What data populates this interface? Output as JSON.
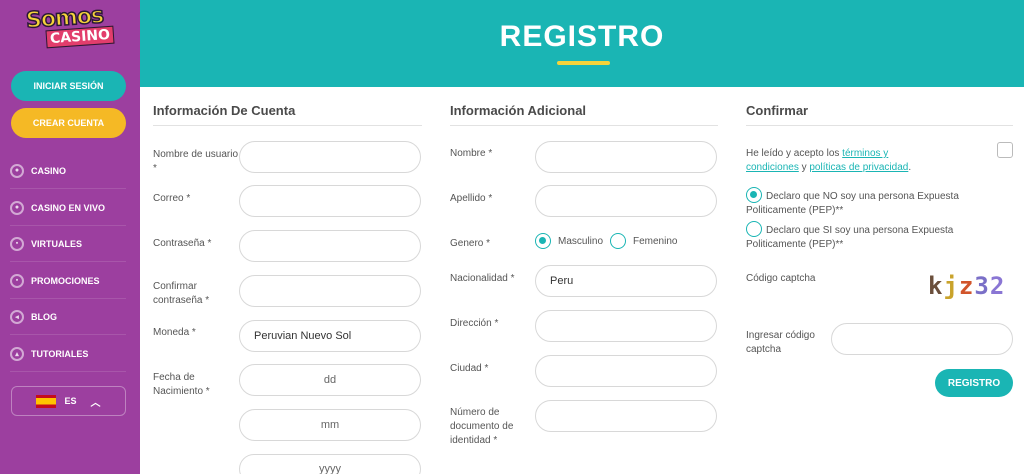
{
  "logo": {
    "line1": "Somos",
    "line2": "CASINO"
  },
  "sidebar": {
    "login_label": "INICIAR SESIÓN",
    "create_label": "CREAR CUENTA",
    "items": [
      {
        "label": "CASINO",
        "icon": "chip-icon"
      },
      {
        "label": "CASINO EN VIVO",
        "icon": "live-chip-icon"
      },
      {
        "label": "VIRTUALES",
        "icon": "gamepad-icon"
      },
      {
        "label": "PROMOCIONES",
        "icon": "gift-icon"
      },
      {
        "label": "BLOG",
        "icon": "megaphone-icon"
      },
      {
        "label": "TUTORIALES",
        "icon": "graduation-icon"
      }
    ],
    "language": "ES"
  },
  "header": {
    "title": "REGISTRO"
  },
  "account": {
    "title": "Información De Cuenta",
    "username_label": "Nombre de usuario *",
    "email_label": "Correo *",
    "password_label": "Contraseña *",
    "confirm_label": "Confirmar contraseña *",
    "currency_label": "Moneda *",
    "currency_value": "Peruvian Nuevo Sol",
    "birth_label": "Fecha de Nacimiento *",
    "dd_placeholder": "dd",
    "mm_placeholder": "mm",
    "yyyy_placeholder": "yyyy"
  },
  "additional": {
    "title": "Información Adicional",
    "name_label": "Nombre *",
    "surname_label": "Apellido *",
    "gender_label": "Genero *",
    "male_label": "Masculino",
    "female_label": "Femenino",
    "nationality_label": "Nacionalidad *",
    "nationality_value": "Peru",
    "address_label": "Dirección *",
    "city_label": "Ciudad *",
    "id_label": "Número de documento de identidad *"
  },
  "confirm": {
    "title": "Confirmar",
    "terms_prefix": "He leído y acepto los ",
    "terms_link": "términos y condiciones",
    "terms_mid": " y ",
    "privacy_link": "políticas de privacidad",
    "terms_suffix": ".",
    "pep_no": "Declaro que NO soy una persona Expuesta Politicamente (PEP)**",
    "pep_yes": "Declaro que SI soy una persona Expuesta Politicamente (PEP)**",
    "captcha_label": "Código captcha",
    "captcha_text": "kjz32",
    "captcha_input_label": "Ingresar código captcha",
    "submit_label": "REGISTRO"
  },
  "colors": {
    "sidebar": "#9c3f9f",
    "accent": "#1ab5b4",
    "yellow": "#f5b925"
  }
}
